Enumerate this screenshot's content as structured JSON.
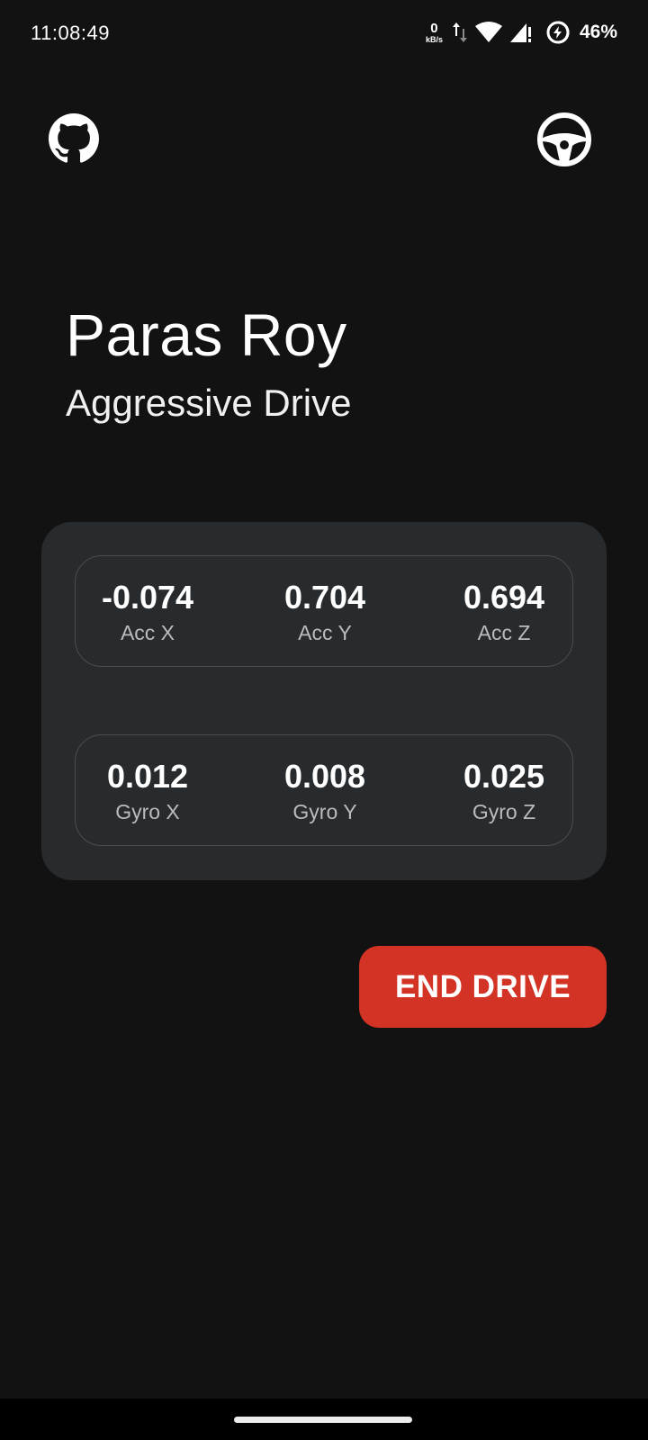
{
  "status_bar": {
    "time": "11:08:49",
    "net_speed_value": "0",
    "net_speed_unit": "kB/s",
    "battery_percent": "46%"
  },
  "header": {
    "github_icon": "github-icon",
    "steering_icon": "steering-wheel-icon"
  },
  "driver": {
    "name": "Paras Roy",
    "drive_type": "Aggressive Drive"
  },
  "accelerometer": {
    "x": {
      "value": "-0.074",
      "label": "Acc X"
    },
    "y": {
      "value": "0.704",
      "label": "Acc Y"
    },
    "z": {
      "value": "0.694",
      "label": "Acc Z"
    }
  },
  "gyroscope": {
    "x": {
      "value": "0.012",
      "label": "Gyro X"
    },
    "y": {
      "value": "0.008",
      "label": "Gyro Y"
    },
    "z": {
      "value": "0.025",
      "label": "Gyro Z"
    }
  },
  "actions": {
    "end_drive_label": "END DRIVE"
  },
  "colors": {
    "background": "#121212",
    "card": "#282b2d",
    "end_button": "#d23325"
  }
}
